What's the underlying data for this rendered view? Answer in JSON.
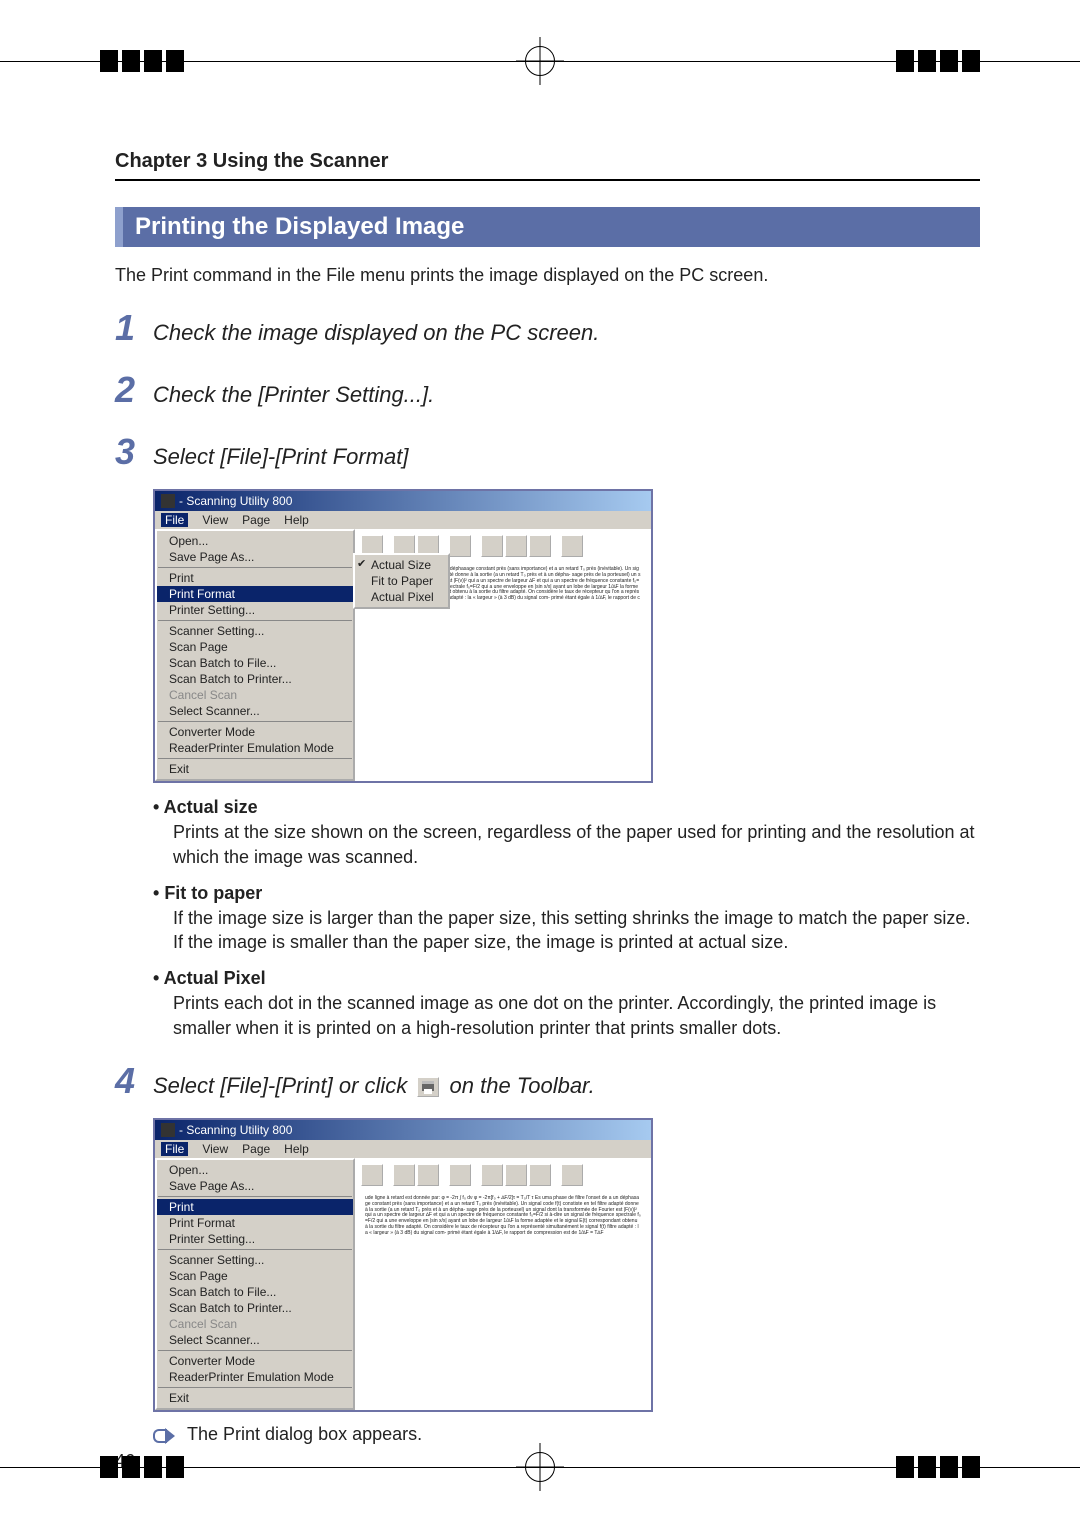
{
  "chapter_title": "Chapter 3 Using the Scanner",
  "section_title": "Printing the Displayed Image",
  "intro_text": "The Print command in the File menu prints the image displayed on the PC screen.",
  "steps": {
    "1": {
      "num": "1",
      "text": "Check the image displayed on the PC screen."
    },
    "2": {
      "num": "2",
      "text": "Check the [Printer Setting...]."
    },
    "3": {
      "num": "3",
      "text": "Select [File]-[Print Format]"
    },
    "4": {
      "num": "4",
      "text_before": "Select [File]-[Print] or click",
      "text_after": "on the Toolbar."
    }
  },
  "screenshot_a": {
    "window_title": "- Scanning Utility 800",
    "menubar": [
      "File",
      "View",
      "Page",
      "Help"
    ],
    "file_menu": [
      "Open...",
      "Save Page As...",
      "---",
      "Print",
      "Print Format",
      "Printer Setting...",
      "---",
      "Scanner Setting...",
      "Scan Page",
      "Scan Batch to File...",
      "Scan Batch to Printer...",
      "Cancel Scan",
      "Select Scanner...",
      "---",
      "Converter Mode",
      "ReaderPrinter Emulation Mode",
      "---",
      "Exit"
    ],
    "file_menu_highlight": "Print Format",
    "file_menu_disabled": [
      "Cancel Scan"
    ],
    "submenu": {
      "items": [
        "Actual Size",
        "Fit to Paper",
        "Actual Pixel"
      ],
      "checked": "Actual Size"
    }
  },
  "bullets": {
    "actual_size": {
      "title": "Actual size",
      "body": "Prints at the size shown on the screen, regardless of the paper used for printing and the resolution at which the image was scanned."
    },
    "fit_to_paper": {
      "title": "Fit to paper",
      "body": "If the image size is larger than the paper size, this setting shrinks the image to match the paper size. If the image is smaller than the paper size, the image is printed at actual size."
    },
    "actual_pixel": {
      "title": "Actual Pixel",
      "body": "Prints each dot in the scanned image as one dot on the printer. Accordingly, the printed image is smaller when it is printed on a high-resolution printer that prints smaller dots."
    }
  },
  "screenshot_b": {
    "window_title": "- Scanning Utility 800",
    "menubar": [
      "File",
      "View",
      "Page",
      "Help"
    ],
    "file_menu": [
      "Open...",
      "Save Page As...",
      "---",
      "Print",
      "Print Format",
      "Printer Setting...",
      "---",
      "Scanner Setting...",
      "Scan Page",
      "Scan Batch to File...",
      "Scan Batch to Printer...",
      "Cancel Scan",
      "Select Scanner...",
      "---",
      "Converter Mode",
      "ReaderPrinter Emulation Mode",
      "---",
      "Exit"
    ],
    "file_menu_highlight": "Print",
    "file_menu_disabled": [
      "Cancel Scan"
    ]
  },
  "result_text": "The Print dialog box appears.",
  "page_number": "46"
}
